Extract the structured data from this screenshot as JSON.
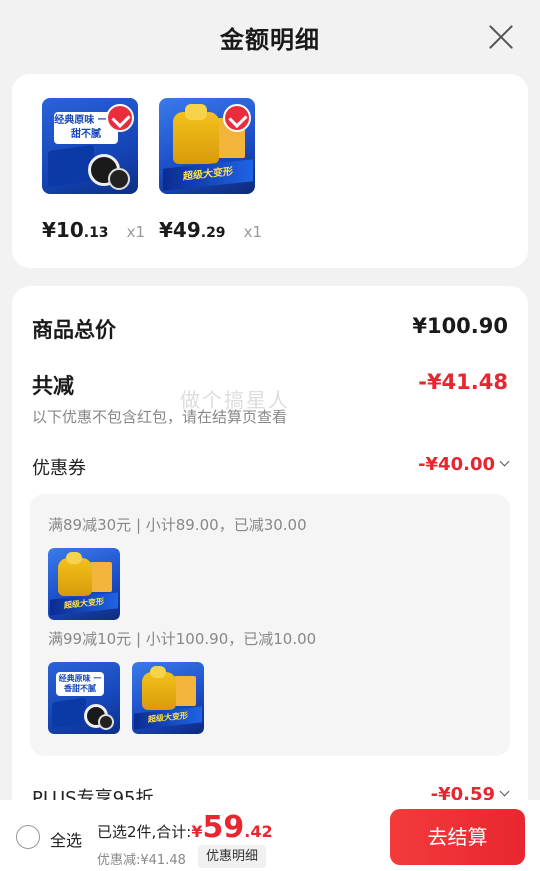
{
  "header": {
    "title": "金额明细"
  },
  "products": [
    {
      "price_int": "¥10",
      "price_dec": ".13",
      "qty": "x1",
      "thumb_text": "经典原味 一香甜不腻"
    },
    {
      "price_int": "¥49",
      "price_dec": ".29",
      "qty": "x1",
      "thumb_text": "超级大变形"
    }
  ],
  "summary": {
    "total_label": "商品总价",
    "total_value": "¥100.90",
    "discount_label": "共减",
    "discount_value": "-¥41.48",
    "discount_note": "以下优惠不包含红包，请在结算页查看",
    "coupon_label": "优惠券",
    "coupon_value": "-¥40.00",
    "coupon_lines": [
      "满89减30元 | 小计89.00，已减30.00",
      "满99减10元 | 小计100.90，已减10.00"
    ],
    "plus_label": "PLUS专享95折",
    "plus_value": "-¥0.59"
  },
  "watermark": "做个搞星人",
  "footer": {
    "select_all": "全选",
    "selected_text": "已选2件,合计:",
    "currency": "¥",
    "total_int": "59",
    "total_dec": ".42",
    "saved_text": "优惠减:¥41.48",
    "detail_button": "优惠明细",
    "checkout_button": "去结算"
  },
  "colors": {
    "accent_red": "#e8262f",
    "background": "#f2f2f2"
  }
}
